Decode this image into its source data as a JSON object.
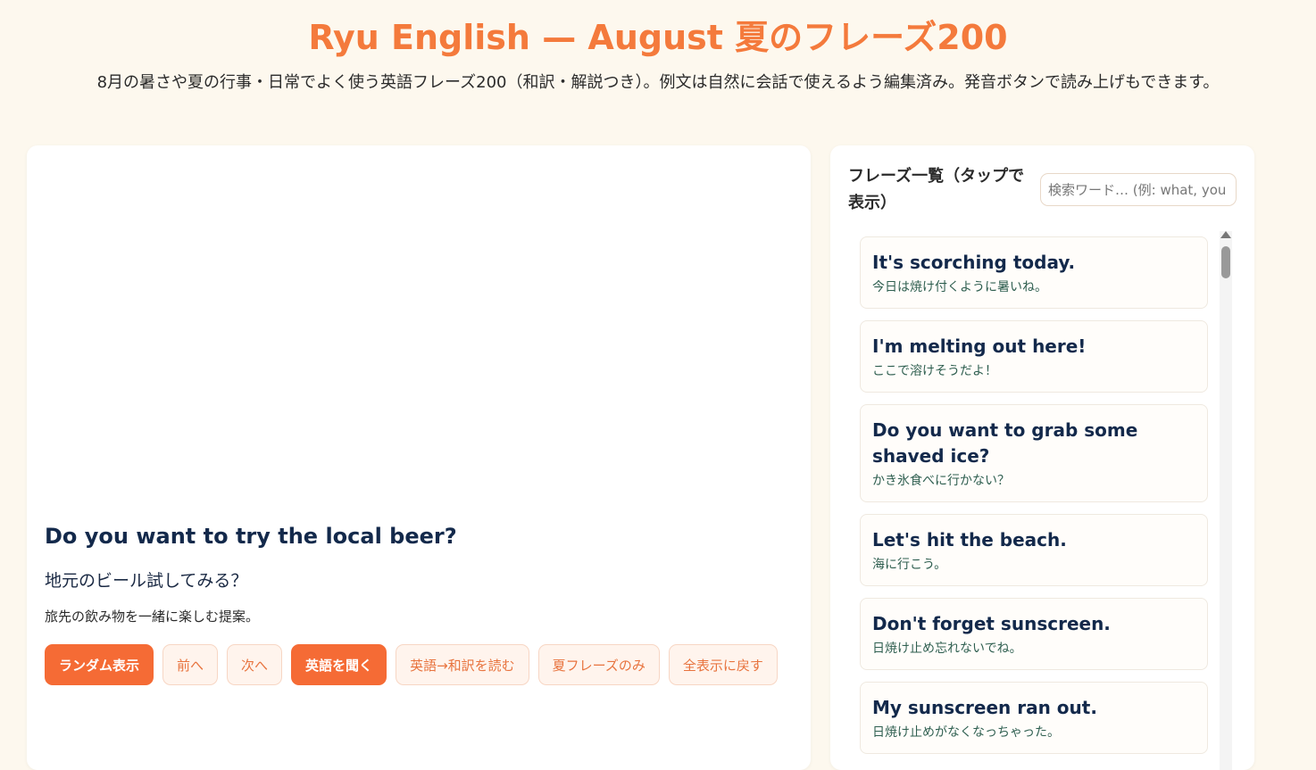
{
  "header": {
    "title": "Ryu English — August 夏のフレーズ200",
    "subtitle": "8月の暑さや夏の行事・日常でよく使う英語フレーズ200（和訳・解説つき）。例文は自然に会話で使えるよう編集済み。発音ボタンで読み上げもできます。"
  },
  "current": {
    "en": "Do you want to try the local beer?",
    "ja": "地元のビール試してみる？",
    "note": "旅先の飲み物を一緒に楽しむ提案。"
  },
  "buttons": {
    "random": "ランダム表示",
    "prev": "前へ",
    "next": "次へ",
    "listen": "英語を聞く",
    "read_both": "英語→和訳を読む",
    "summer_only": "夏フレーズのみ",
    "show_all": "全表示に戻す"
  },
  "side": {
    "title": "フレーズ一覧（タップで表示）",
    "search_placeholder": "検索ワード… (例: what, you"
  },
  "phrases": [
    {
      "en": "It's scorching today.",
      "ja": "今日は焼け付くように暑いね。"
    },
    {
      "en": "I'm melting out here!",
      "ja": "ここで溶けそうだよ！"
    },
    {
      "en": "Do you want to grab some shaved ice?",
      "ja": "かき氷食べに行かない？"
    },
    {
      "en": "Let's hit the beach.",
      "ja": "海に行こう。"
    },
    {
      "en": "Don't forget sunscreen.",
      "ja": "日焼け止め忘れないでね。"
    },
    {
      "en": "My sunscreen ran out.",
      "ja": "日焼け止めがなくなっちゃった。"
    }
  ],
  "colors": {
    "accent": "#f56b35",
    "title": "#f47a3c",
    "background": "#fdf8ee"
  }
}
